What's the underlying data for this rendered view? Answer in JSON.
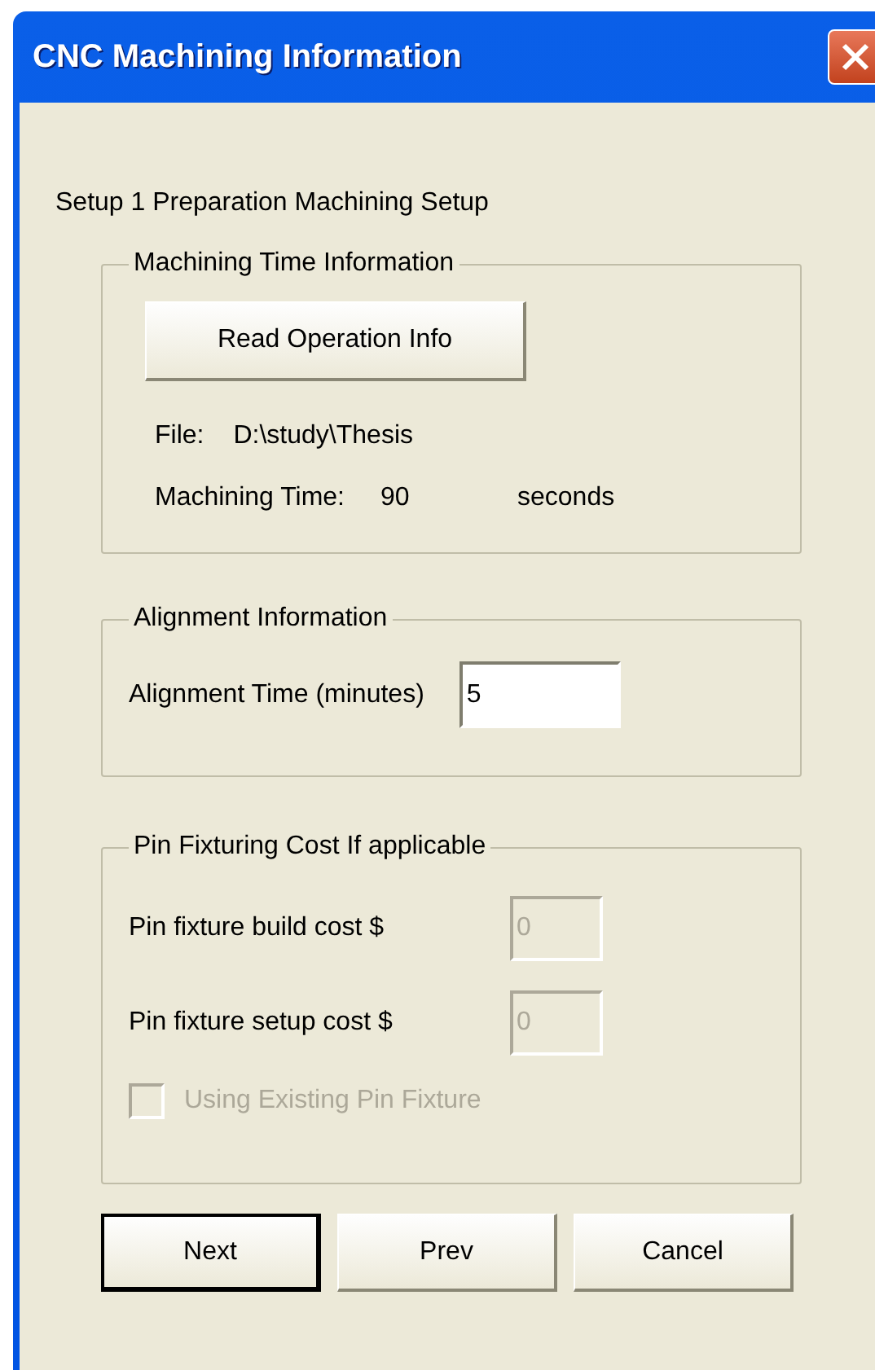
{
  "window": {
    "title": "CNC Machining Information"
  },
  "heading": "Setup 1 Preparation Machining Setup",
  "machining_time": {
    "title": "Machining Time Information",
    "read_button": "Read Operation Info",
    "file_label": "File:",
    "file_value": "D:\\study\\Thesis",
    "time_label": "Machining Time:",
    "time_value": "90",
    "time_unit": "seconds"
  },
  "alignment": {
    "title": "Alignment Information",
    "label": "Alignment Time (minutes)",
    "value": "5"
  },
  "pin_fixturing": {
    "title": "Pin Fixturing Cost If applicable",
    "fields": [
      {
        "label": "Pin fixture build cost $",
        "value": "0",
        "disabled": true
      },
      {
        "label": "Pin fixture setup cost $",
        "value": "0",
        "disabled": true
      }
    ],
    "checkbox": {
      "label": "Using Existing Pin Fixture",
      "checked": false,
      "disabled": true
    }
  },
  "buttons": [
    {
      "label": "Next",
      "default": true
    },
    {
      "label": "Prev",
      "default": false
    },
    {
      "label": "Cancel",
      "default": false
    }
  ]
}
